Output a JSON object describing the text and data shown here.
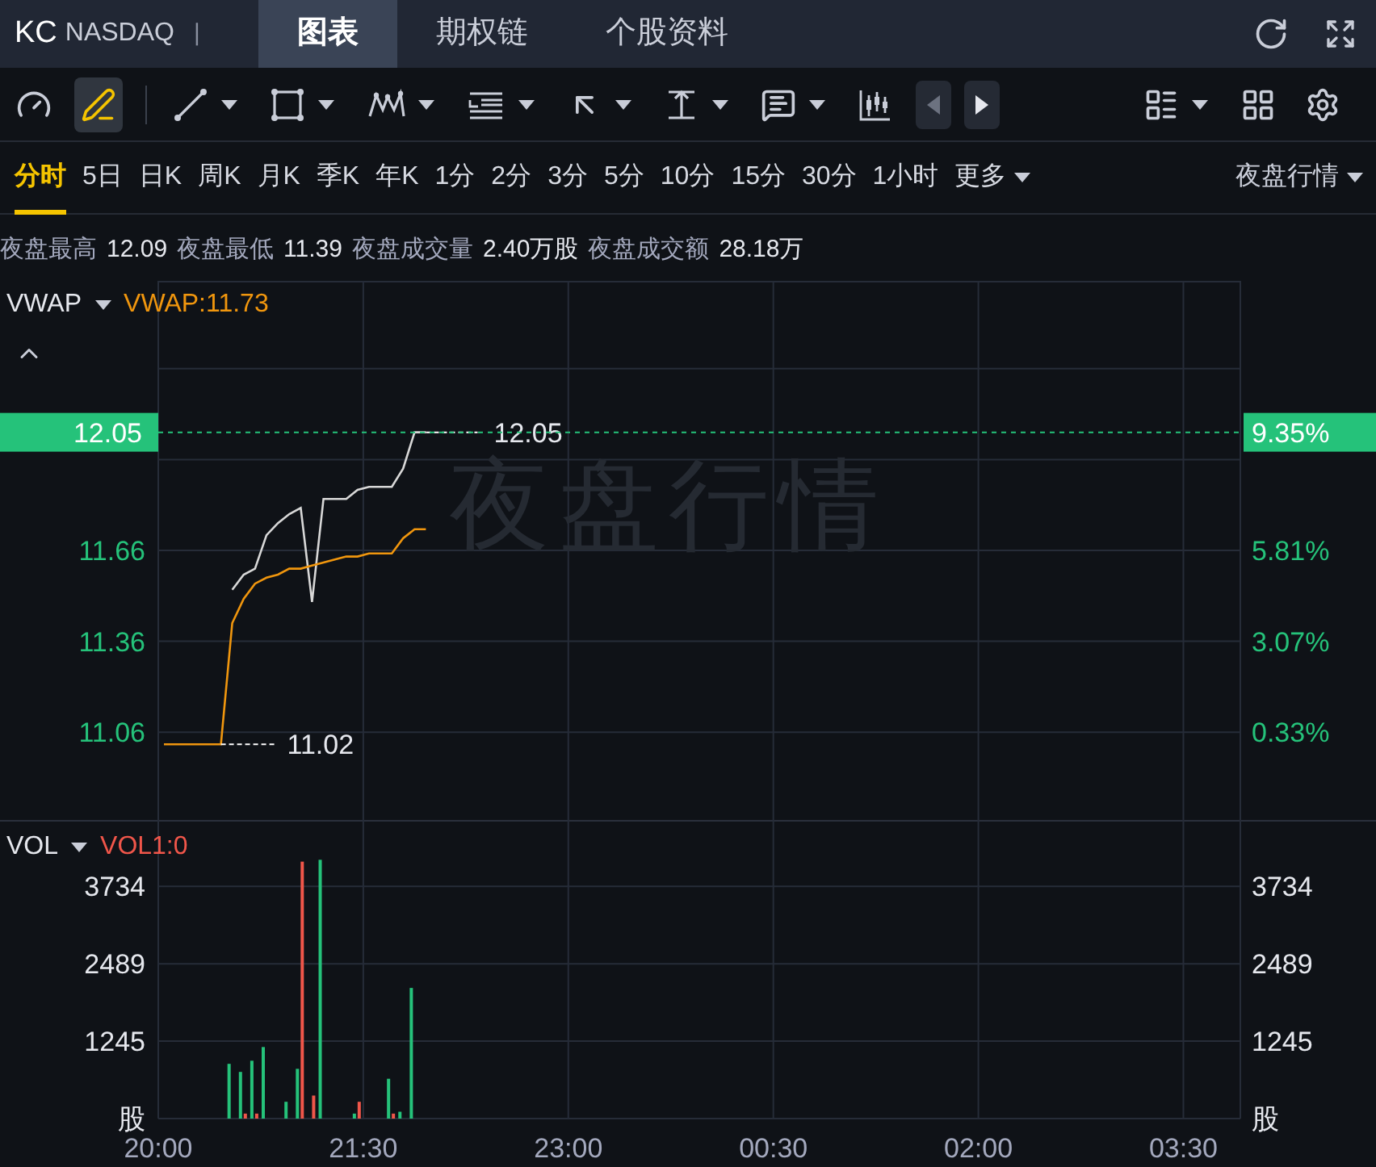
{
  "header": {
    "symbol": "KC",
    "exchange": "NASDAQ",
    "separator": "|",
    "tabs": [
      {
        "label": "图表",
        "selected": true
      },
      {
        "label": "期权链",
        "selected": false
      },
      {
        "label": "个股资料",
        "selected": false
      }
    ]
  },
  "toolbar": {
    "tools": [
      {
        "kind": "gauge",
        "selected": false,
        "dropdown": false
      },
      {
        "kind": "pencil",
        "selected": true,
        "dropdown": false
      },
      {
        "kind": "line",
        "selected": false,
        "dropdown": true
      },
      {
        "kind": "rectangle",
        "selected": false,
        "dropdown": true
      },
      {
        "kind": "pattern",
        "selected": false,
        "dropdown": true
      },
      {
        "kind": "fibonacci",
        "selected": false,
        "dropdown": true
      },
      {
        "kind": "arrow",
        "selected": false,
        "dropdown": true
      },
      {
        "kind": "measure",
        "selected": false,
        "dropdown": true
      },
      {
        "kind": "textbox",
        "selected": false,
        "dropdown": true
      },
      {
        "kind": "candles",
        "selected": false,
        "dropdown": false
      },
      {
        "kind": "prev",
        "selected": false,
        "dropdown": false
      },
      {
        "kind": "next",
        "selected": false,
        "dropdown": false
      },
      {
        "kind": "list",
        "selected": false,
        "dropdown": true
      },
      {
        "kind": "grid",
        "selected": false,
        "dropdown": false
      },
      {
        "kind": "settings",
        "selected": false,
        "dropdown": false
      }
    ]
  },
  "periods": {
    "items": [
      {
        "label": "分时",
        "selected": true
      },
      {
        "label": "5日",
        "selected": false
      },
      {
        "label": "日K",
        "selected": false
      },
      {
        "label": "周K",
        "selected": false
      },
      {
        "label": "月K",
        "selected": false
      },
      {
        "label": "季K",
        "selected": false
      },
      {
        "label": "年K",
        "selected": false
      },
      {
        "label": "1分",
        "selected": false
      },
      {
        "label": "2分",
        "selected": false
      },
      {
        "label": "3分",
        "selected": false
      },
      {
        "label": "5分",
        "selected": false
      },
      {
        "label": "10分",
        "selected": false
      },
      {
        "label": "15分",
        "selected": false
      },
      {
        "label": "30分",
        "selected": false
      },
      {
        "label": "1小时",
        "selected": false
      }
    ],
    "more": "更多",
    "session": "夜盘行情"
  },
  "stats": [
    {
      "label": "夜盘最高",
      "value": "12.09"
    },
    {
      "label": "夜盘最低",
      "value": "11.39"
    },
    {
      "label": "夜盘成交量",
      "value": "2.40万股"
    },
    {
      "label": "夜盘成交额",
      "value": "28.18万"
    }
  ],
  "price_chart": {
    "indicator": "VWAP",
    "indicator_value": "VWAP:11.73",
    "watermark": "夜盘行情",
    "current_price": "12.05",
    "current_change": "9.35%",
    "last_label": "12.05",
    "start_label": "11.02",
    "left_labels": [
      "11.66",
      "11.36",
      "11.06"
    ],
    "right_labels": [
      "5.81%",
      "3.07%",
      "0.33%"
    ],
    "chart_data": {
      "type": "line",
      "grid": true,
      "categories": [
        null,
        null,
        null,
        null,
        null,
        null,
        null,
        null,
        null,
        null,
        null,
        null,
        null,
        null,
        null,
        null,
        null,
        null,
        null,
        null,
        null,
        null,
        null,
        null,
        null,
        null,
        null,
        null,
        null,
        null,
        null,
        null,
        null,
        null,
        null,
        null,
        null,
        null,
        null,
        null,
        null,
        null,
        null,
        null,
        null,
        null,
        null,
        null,
        null,
        null,
        null,
        null,
        null,
        null,
        null,
        null,
        null,
        null,
        null,
        null,
        null,
        null,
        null,
        null,
        null,
        null,
        null,
        null,
        null,
        null,
        null,
        null,
        null,
        null,
        null,
        null,
        null,
        null,
        null,
        null,
        null,
        null,
        null,
        null,
        null,
        null,
        null,
        null,
        null,
        null,
        null,
        null,
        null,
        null,
        null
      ],
      "series": [
        {
          "color": "#d8d8d8",
          "values": [
            null,
            null,
            null,
            null,
            null,
            null,
            11.53,
            11.58,
            11.6,
            11.71,
            11.75,
            11.78,
            11.8,
            11.49,
            11.83,
            11.83,
            11.83,
            11.86,
            11.87,
            11.87,
            11.87,
            11.93,
            12.05,
            12.05,
            null,
            null,
            null,
            null,
            null,
            null,
            null,
            null,
            null,
            null,
            null,
            null,
            null,
            null,
            null,
            null,
            null,
            null,
            null,
            null,
            null,
            null,
            null,
            null,
            null,
            null,
            null,
            null,
            null,
            null,
            null,
            null,
            null,
            null,
            null,
            null,
            null,
            null,
            null,
            null,
            null,
            null,
            null,
            null,
            null,
            null,
            null,
            null,
            null,
            null,
            null,
            null,
            null,
            null,
            null,
            null,
            null,
            null,
            null,
            null,
            null,
            null,
            null,
            null,
            null,
            null,
            null,
            null,
            null,
            null,
            null
          ]
        },
        {
          "color": "#f0960e",
          "values": [
            11.02,
            11.02,
            11.02,
            11.02,
            11.02,
            11.02,
            11.42,
            11.5,
            11.55,
            11.57,
            11.58,
            11.6,
            11.6,
            11.61,
            11.62,
            11.63,
            11.64,
            11.64,
            11.65,
            11.65,
            11.65,
            11.7,
            11.73,
            11.73,
            null,
            null,
            null,
            null,
            null,
            null,
            null,
            null,
            null,
            null,
            null,
            null,
            null,
            null,
            null,
            null,
            null,
            null,
            null,
            null,
            null,
            null,
            null,
            null,
            null,
            null,
            null,
            null,
            null,
            null,
            null,
            null,
            null,
            null,
            null,
            null,
            null,
            null,
            null,
            null,
            null,
            null,
            null,
            null,
            null,
            null,
            null,
            null,
            null,
            null,
            null,
            null,
            null,
            null,
            null,
            null,
            null,
            null,
            null,
            null,
            null,
            null,
            null,
            null,
            null,
            null,
            null,
            null,
            null,
            null,
            null
          ]
        }
      ],
      "ylim": [
        10.77,
        12.55
      ],
      "yticks": [
        11.06,
        11.36,
        11.66
      ]
    }
  },
  "volume_chart": {
    "indicator": "VOL",
    "indicator_value": "VOL1:0",
    "unit_left": "股",
    "unit_right": "股",
    "left_labels": [
      "3734",
      "2489",
      "1245"
    ],
    "right_labels": [
      "3734",
      "2489",
      "1245"
    ],
    "time_labels": [
      "20:00",
      "21:30",
      "23:00",
      "00:30",
      "02:00",
      "03:30"
    ],
    "chart_data": {
      "type": "bar",
      "grid": true,
      "categories": [
        null,
        null,
        null,
        null,
        null,
        null,
        null,
        null,
        null,
        null,
        null,
        null,
        null,
        null,
        null,
        null,
        null,
        null,
        null,
        null,
        null,
        null,
        null,
        null,
        null,
        null,
        null,
        null,
        null,
        null,
        null,
        null,
        null,
        null,
        null,
        null,
        null,
        null,
        null,
        null,
        null,
        null,
        null,
        null,
        null,
        null,
        null,
        null,
        null,
        null,
        null,
        null,
        null,
        null,
        null,
        null,
        null,
        null,
        null,
        null,
        null,
        null,
        null,
        null,
        null,
        null,
        null,
        null,
        null,
        null,
        null,
        null,
        null,
        null,
        null,
        null,
        null,
        null,
        null,
        null,
        null,
        null,
        null,
        null,
        null,
        null,
        null,
        null,
        null,
        null,
        null,
        null,
        null,
        null,
        null
      ],
      "series": [
        {
          "color": "#25c27a",
          "values": [
            null,
            null,
            null,
            null,
            null,
            null,
            880,
            750,
            930,
            1150,
            null,
            270,
            800,
            null,
            4160,
            null,
            null,
            80,
            null,
            null,
            640,
            110,
            2100,
            null,
            null,
            null,
            null,
            null,
            null,
            null,
            null,
            null,
            null,
            null,
            null,
            null,
            null,
            null,
            null,
            null,
            null,
            null,
            null,
            null,
            null,
            null,
            null,
            null,
            null,
            null,
            null,
            null,
            null,
            null,
            null,
            null,
            null,
            null,
            null,
            null,
            null,
            null,
            null,
            null,
            null,
            null,
            null,
            null,
            null,
            null,
            null,
            null,
            null,
            null,
            null,
            null,
            null,
            null,
            null,
            null,
            null,
            null,
            null,
            null,
            null,
            null,
            null,
            null,
            null,
            null,
            null,
            null,
            null,
            null,
            null
          ]
        },
        {
          "color": "#f0564a",
          "values": [
            null,
            null,
            null,
            null,
            null,
            null,
            null,
            80,
            80,
            null,
            null,
            null,
            4130,
            370,
            null,
            null,
            null,
            270,
            null,
            null,
            80,
            null,
            null,
            null,
            null,
            null,
            null,
            null,
            null,
            null,
            null,
            null,
            null,
            null,
            null,
            null,
            null,
            null,
            null,
            null,
            null,
            null,
            null,
            null,
            null,
            null,
            null,
            null,
            null,
            null,
            null,
            null,
            null,
            null,
            null,
            null,
            null,
            null,
            null,
            null,
            null,
            null,
            null,
            null,
            null,
            null,
            null,
            null,
            null,
            null,
            null,
            null,
            null,
            null,
            null,
            null,
            null,
            null,
            null,
            null,
            null,
            null,
            null,
            null,
            null,
            null,
            null,
            null,
            null,
            null,
            null,
            null,
            null,
            null,
            null
          ]
        }
      ],
      "ylim": [
        0,
        4800
      ],
      "yticks": [
        1245,
        2489,
        3734
      ]
    }
  }
}
